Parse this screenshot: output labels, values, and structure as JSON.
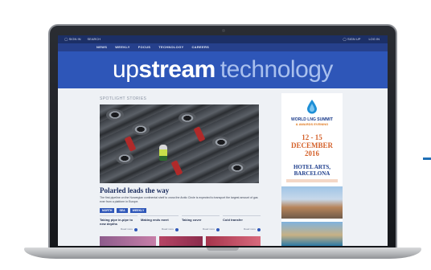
{
  "site": {
    "topbar": {
      "left": [
        "◯ SIGN IN",
        "SEARCH"
      ],
      "right": [
        "◯ SIGN UP",
        "LOG IN"
      ]
    },
    "nav": [
      "NEWS",
      "WEEKLY",
      "FOCUS",
      "TECHNOLOGY",
      "CAREERS"
    ],
    "logo": {
      "part1": "up",
      "part2": "stream",
      "part3": "technology"
    }
  },
  "main": {
    "section_label": "SPOTLIGHT STORIES",
    "headline": "Polarled leads the way",
    "summary": "The first pipeline on the Norwegian continental shelf to cross the Arctic Circle is expected to transport the largest amount of gas ever from a platform in Europe.",
    "tags": [
      "NORTH",
      "SEA",
      "WEEKLY"
    ],
    "stories": [
      {
        "title": "Taking pipe in-pipe to new depths",
        "more": "Read more"
      },
      {
        "title": "Making ends meet",
        "more": "Read more"
      },
      {
        "title": "Taking cover",
        "more": "Read more"
      },
      {
        "title": "Cold transfer",
        "more": "Read more"
      }
    ]
  },
  "ad": {
    "event_line1": "WORLD LNG SUMMIT",
    "event_line2": "& AWARDS EVENING",
    "dates_line1": "12 - 15",
    "dates_line2": "DECEMBER",
    "dates_line3": "2016",
    "venue_line1": "HOTEL ARTS,",
    "venue_line2": "BARCELONA",
    "drop_color": "#1e8fd6"
  },
  "colors": {
    "accent": "#2e56b8",
    "navy": "#1c2f66",
    "orange": "#d4612a"
  }
}
